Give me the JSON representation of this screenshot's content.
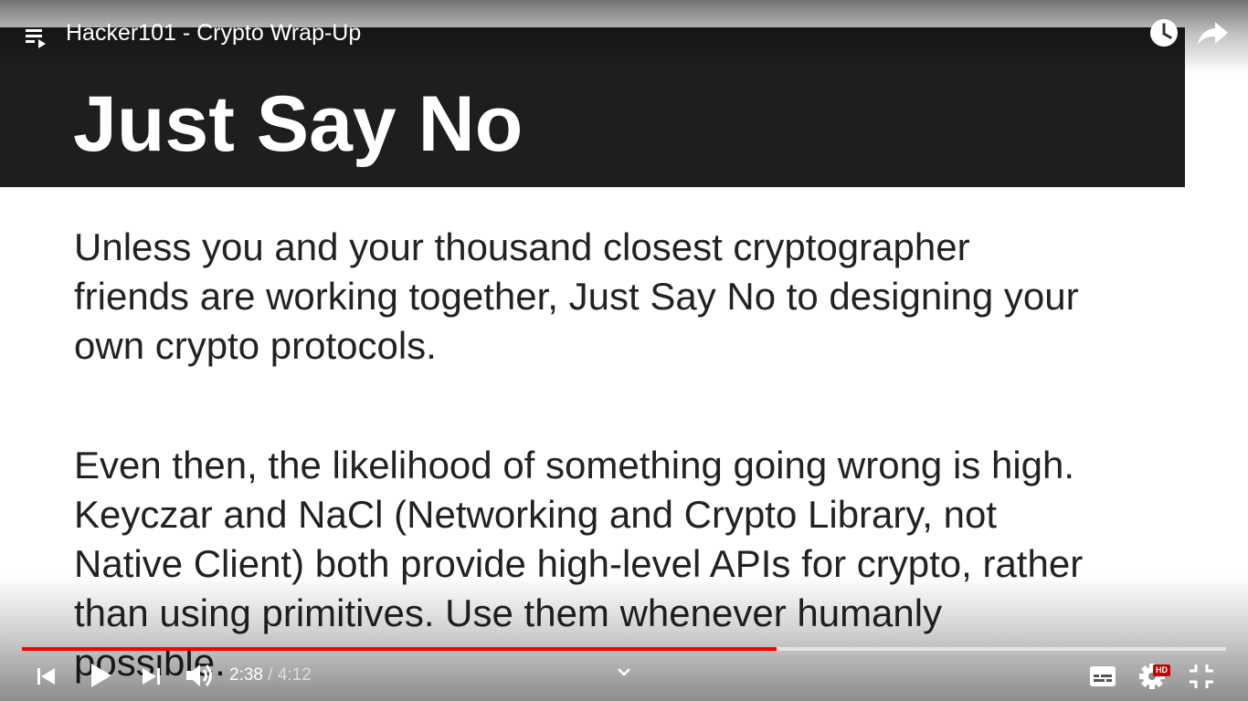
{
  "player": {
    "title": "Hacker101 - Crypto Wrap-Up",
    "icons": {
      "playlist": "playlist-icon",
      "watch_later": "clock-icon",
      "share": "share-arrow-icon"
    }
  },
  "slide": {
    "title": "Just Say No",
    "header_color": "#1e1e1e",
    "paragraph_1": "Unless you and your thousand closest cryptographer\nfriends are working together, Just Say No to designing your\nown crypto protocols.",
    "paragraph_2": "Even then, the likelihood of something going wrong is high.\nKeyczar and NaCl (Networking and Crypto Library, not\nNative Client) both provide high-level APIs for crypto, rather\nthan using primitives.  Use them whenever humanly\npossible."
  },
  "controls": {
    "current_time": "2:38",
    "separator": " / ",
    "duration": "4:12",
    "progress_fraction": 0.627,
    "hd_badge": "HD",
    "progress_color": "#ff0000",
    "icons": {
      "previous": "skip-previous-icon",
      "play": "play-icon",
      "next": "skip-next-icon",
      "volume": "volume-icon",
      "more": "chevron-down-icon",
      "subtitles": "subtitles-icon",
      "settings": "gear-icon",
      "fullscreen_exit": "fullscreen-exit-icon"
    }
  }
}
